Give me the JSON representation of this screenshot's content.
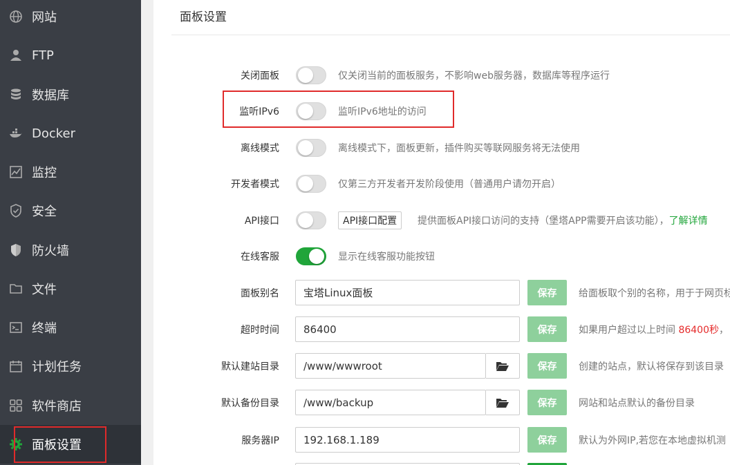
{
  "sidebar": {
    "items": [
      {
        "label": "网站",
        "icon": "globe-icon"
      },
      {
        "label": "FTP",
        "icon": "ftp-user-icon"
      },
      {
        "label": "数据库",
        "icon": "database-icon"
      },
      {
        "label": "Docker",
        "icon": "docker-icon"
      },
      {
        "label": "监控",
        "icon": "monitor-chart-icon"
      },
      {
        "label": "安全",
        "icon": "shield-icon"
      },
      {
        "label": "防火墙",
        "icon": "firewall-shield-icon"
      },
      {
        "label": "文件",
        "icon": "folder-icon"
      },
      {
        "label": "终端",
        "icon": "terminal-icon"
      },
      {
        "label": "计划任务",
        "icon": "calendar-icon"
      },
      {
        "label": "软件商店",
        "icon": "grid-icon"
      },
      {
        "label": "面板设置",
        "icon": "gear-icon",
        "active": true
      }
    ]
  },
  "main": {
    "title": "面板设置",
    "toggles": [
      {
        "label": "关闭面板",
        "on": false,
        "desc": "仅关闭当前的面板服务，不影响web服务器，数据库等程序运行"
      },
      {
        "label": "监听IPv6",
        "on": false,
        "desc": "监听IPv6地址的访问"
      },
      {
        "label": "离线模式",
        "on": false,
        "desc": "离线模式下，面板更新，插件购买等联网服务将无法使用"
      },
      {
        "label": "开发者模式",
        "on": false,
        "desc": "仅第三方开发者开发阶段使用（普通用户请勿开启）"
      },
      {
        "label": "API接口",
        "on": false,
        "button": "API接口配置",
        "desc": "提供面板API接口访问的支持（堡塔APP需要开启该功能），",
        "link": "了解详情"
      },
      {
        "label": "在线客服",
        "on": true,
        "desc": "显示在线客服功能按钮"
      }
    ],
    "fields": [
      {
        "label": "面板别名",
        "value": "宝塔Linux面板",
        "save": "保存",
        "desc": "给面板取个别的名称，用于于网页标"
      },
      {
        "label": "超时时间",
        "value": "86400",
        "save": "保存",
        "desc_pre": "如果用户超过以上时间 ",
        "desc_red": "86400秒",
        "desc_post": "，"
      },
      {
        "label": "默认建站目录",
        "value": "/www/wwwroot",
        "save": "保存",
        "folder": true,
        "desc": "创建的站点，默认将保存到该目录"
      },
      {
        "label": "默认备份目录",
        "value": "/www/backup",
        "save": "保存",
        "folder": true,
        "desc": "网站和站点默认的备份目录"
      },
      {
        "label": "服务器IP",
        "value": "192.168.1.189",
        "save": "保存",
        "desc": "默认为外网IP,若您在本地虚拟机测"
      }
    ]
  },
  "colors": {
    "sidebar_bg": "#3a3e45",
    "accent_green": "#20a53a",
    "save_btn": "#8ed09c",
    "highlight_red": "#e02a2a"
  }
}
